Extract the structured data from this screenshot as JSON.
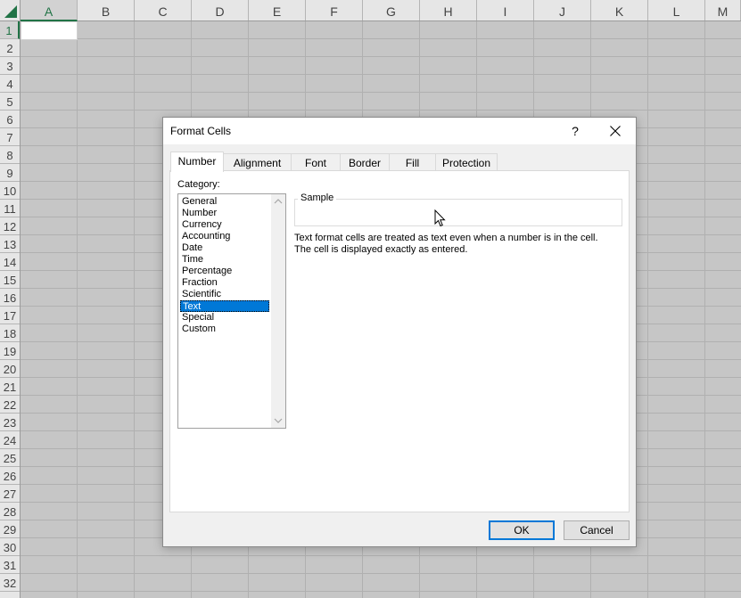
{
  "spreadsheet": {
    "columns": [
      "A",
      "B",
      "C",
      "D",
      "E",
      "F",
      "G",
      "H",
      "I",
      "J",
      "K",
      "L",
      "M"
    ],
    "rows": [
      "1",
      "2",
      "3",
      "4",
      "5",
      "6",
      "7",
      "8",
      "9",
      "10",
      "11",
      "12",
      "13",
      "14",
      "15",
      "16",
      "17",
      "18",
      "19",
      "20",
      "21",
      "22",
      "23",
      "24",
      "25",
      "26",
      "27",
      "28",
      "29",
      "30",
      "31",
      "32"
    ],
    "selected_column": "A",
    "selected_row": "1",
    "accent_color": "#217346"
  },
  "dialog": {
    "title": "Format Cells",
    "help_label": "?",
    "tabs": [
      {
        "label": "Number",
        "active": true
      },
      {
        "label": "Alignment",
        "active": false
      },
      {
        "label": "Font",
        "active": false
      },
      {
        "label": "Border",
        "active": false
      },
      {
        "label": "Fill",
        "active": false
      },
      {
        "label": "Protection",
        "active": false
      }
    ],
    "category_label": "Category:",
    "categories": [
      "General",
      "Number",
      "Currency",
      "Accounting",
      "Date",
      "Time",
      "Percentage",
      "Fraction",
      "Scientific",
      "Text",
      "Special",
      "Custom"
    ],
    "selected_category": "Text",
    "sample_label": "Sample",
    "sample_value": "",
    "description_lines": [
      "Text format cells are treated as text even when a number is in the cell.",
      "The cell is displayed exactly as entered."
    ],
    "ok_label": "OK",
    "cancel_label": "Cancel",
    "selection_color": "#0078d7"
  }
}
